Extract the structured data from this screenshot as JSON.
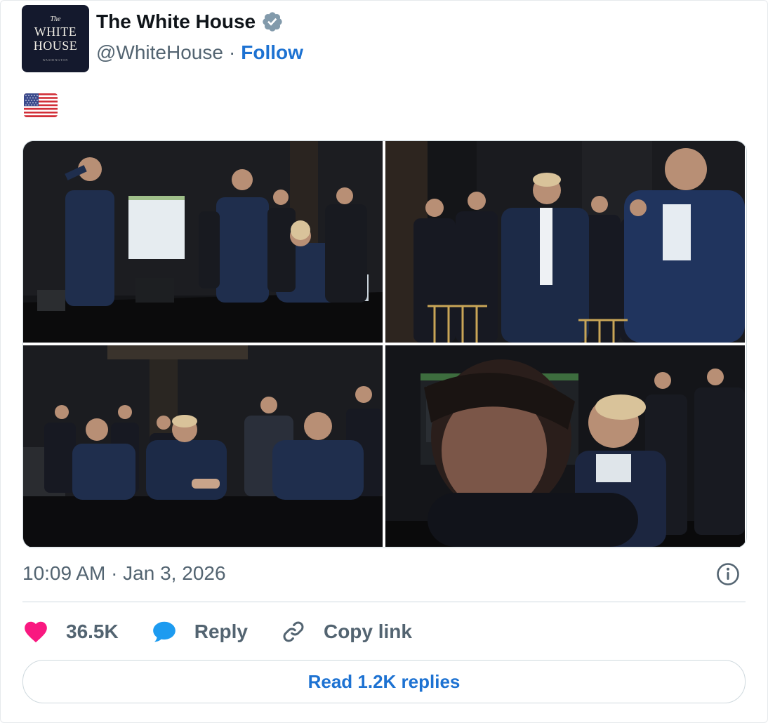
{
  "account": {
    "name": "The White House",
    "handle": "@WhiteHouse",
    "separator": "·",
    "follow_label": "Follow",
    "avatar": {
      "the": "The",
      "line1": "WHITE",
      "line2": "HOUSE",
      "sub": "WASHINGTON"
    }
  },
  "tweet": {
    "text_icon": "us-flag-emoji",
    "timestamp": "10:09 AM · Jan 3, 2026"
  },
  "media": [
    {
      "name": "photo-situation-room-briefing"
    },
    {
      "name": "photo-standing-group"
    },
    {
      "name": "photo-seated-table"
    },
    {
      "name": "photo-monitor-closeup"
    }
  ],
  "actions": {
    "like_count": "36.5K",
    "reply_label": "Reply",
    "copy_link_label": "Copy link"
  },
  "read_replies_label": "Read 1.2K replies",
  "colors": {
    "link": "#1d72d2",
    "like": "#f91880",
    "reply": "#1d9bf0",
    "muted": "#536471",
    "verified": "#829aab"
  }
}
